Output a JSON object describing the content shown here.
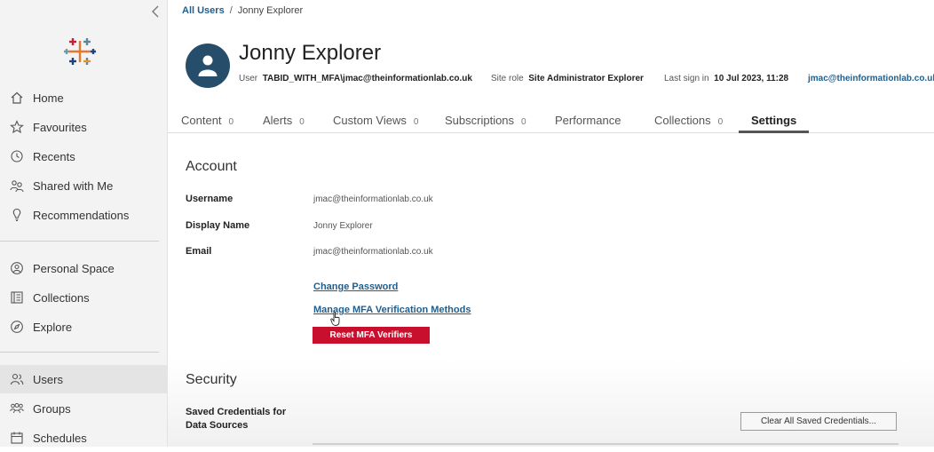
{
  "sidebar": {
    "nav_top": [
      {
        "label": "Home",
        "icon": "home-icon"
      },
      {
        "label": "Favourites",
        "icon": "star-icon"
      },
      {
        "label": "Recents",
        "icon": "clock-icon"
      },
      {
        "label": "Shared with Me",
        "icon": "shared-users-icon"
      },
      {
        "label": "Recommendations",
        "icon": "lightbulb-icon"
      }
    ],
    "nav_mid": [
      {
        "label": "Personal Space",
        "icon": "person-circle-icon"
      },
      {
        "label": "Collections",
        "icon": "collections-icon"
      },
      {
        "label": "Explore",
        "icon": "compass-icon"
      }
    ],
    "nav_bottom": [
      {
        "label": "Users",
        "icon": "users-icon",
        "active": true
      },
      {
        "label": "Groups",
        "icon": "groups-icon"
      },
      {
        "label": "Schedules",
        "icon": "calendar-icon"
      }
    ]
  },
  "breadcrumb": {
    "parent": "All Users",
    "separator": "/",
    "current": "Jonny Explorer"
  },
  "user": {
    "name": "Jonny Explorer",
    "user_label": "User",
    "user_value": "TABID_WITH_MFA\\jmac@theinformationlab.co.uk",
    "site_role_label": "Site role",
    "site_role_value": "Site Administrator Explorer",
    "last_sign_in_label": "Last sign in",
    "last_sign_in_value": "10 Jul 2023, 11:28",
    "email_link": "jmac@theinformationlab.co.uk"
  },
  "tabs": [
    {
      "label": "Content",
      "count": "0"
    },
    {
      "label": "Alerts",
      "count": "0"
    },
    {
      "label": "Custom Views",
      "count": "0"
    },
    {
      "label": "Subscriptions",
      "count": "0"
    },
    {
      "label": "Performance",
      "count": ""
    },
    {
      "label": "Collections",
      "count": "0"
    },
    {
      "label": "Settings",
      "count": "",
      "active": true
    }
  ],
  "account": {
    "title": "Account",
    "username_label": "Username",
    "username_value": "jmac@theinformationlab.co.uk",
    "display_name_label": "Display Name",
    "display_name_value": "Jonny Explorer",
    "email_label": "Email",
    "email_value": "jmac@theinformationlab.co.uk",
    "change_password": "Change Password",
    "manage_mfa": "Manage MFA Verification Methods",
    "reset_mfa": "Reset MFA Verifiers"
  },
  "security": {
    "title": "Security",
    "saved_credentials_label_1": "Saved Credentials for",
    "saved_credentials_label_2": "Data Sources",
    "clear_button": "Clear All Saved Credentials..."
  },
  "colors": {
    "link": "#1f5e8e",
    "avatar_bg": "#264e6a",
    "danger": "#c8102e",
    "sidebar_bg": "#f3f3f3"
  }
}
